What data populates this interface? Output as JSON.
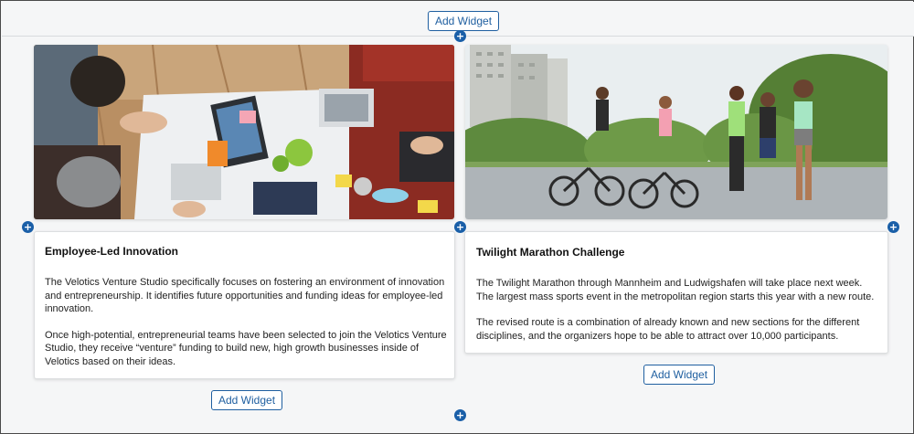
{
  "top": {
    "add_widget_label": "Add Widget"
  },
  "plus_icon": "+",
  "cards": [
    {
      "image_alt": "team collaborating around a desk with laptops",
      "title": "Employee-Led Innovation",
      "paragraphs": [
        "The Velotics Venture Studio specifically focuses on fostering an environment of innovation and entrepreneurship. It identifies future opportunities and funding ideas for employee-led innovation.",
        "Once high-potential, entrepreneurial teams have been selected to join the Velotics Venture Studio, they receive “venture” funding to build new, high growth businesses inside of Velotics based on their ideas."
      ],
      "add_widget_label": "Add Widget"
    },
    {
      "image_alt": "runners and cyclists in a park",
      "title": "Twilight Marathon Challenge",
      "paragraphs": [
        "The Twilight Marathon through Mannheim and Ludwigshafen will take place next week. The largest mass sports event in the metropolitan region starts this year with a new route.",
        "The revised route is a combination of already known and new sections for the different disciplines, and the organizers hope to be able to attract over 10,000 participants."
      ],
      "add_widget_label": "Add Widget"
    }
  ],
  "colors": {
    "accent": "#1f5fa0",
    "plus": "#1a5fa8",
    "background": "#f5f6f7"
  }
}
